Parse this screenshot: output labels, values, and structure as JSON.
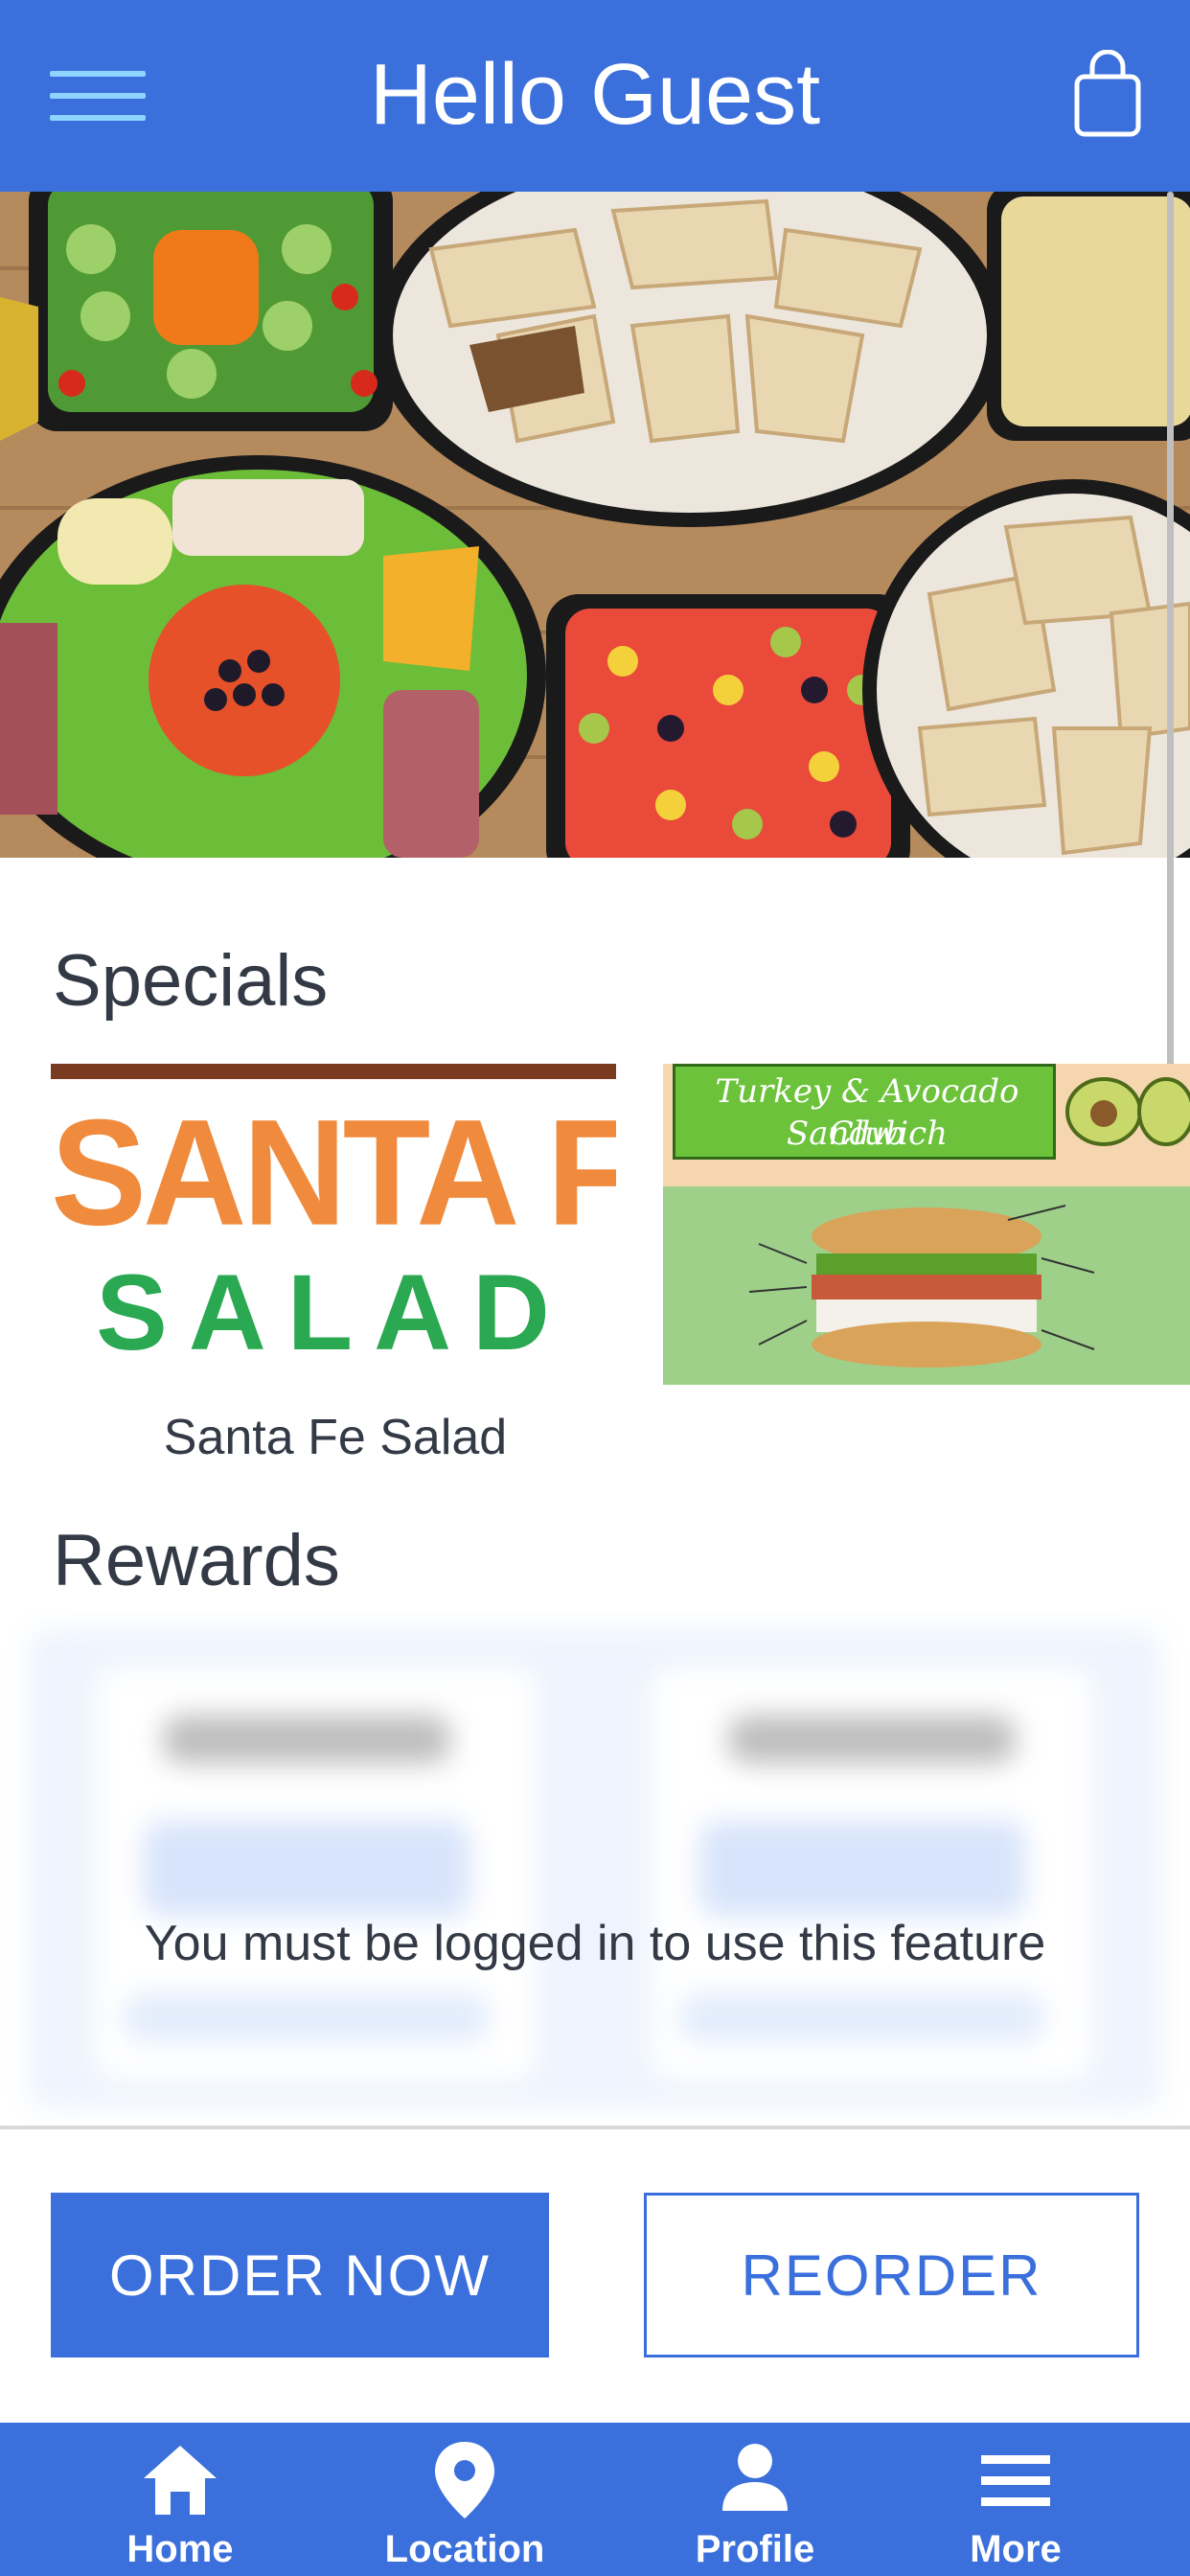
{
  "header": {
    "title": "Hello Guest",
    "menu_icon": "hamburger-menu-icon",
    "cart_icon": "shopping-bag-icon"
  },
  "hero": {
    "description_icon": "catering-platters-photo"
  },
  "specials": {
    "title": "Specials",
    "items": [
      {
        "label": "Santa Fe Salad",
        "art_line1": "SANTA FE",
        "art_line2": "SALAD"
      },
      {
        "label": "",
        "art_line1": "Turkey & Avocado Club",
        "art_line2": "Sandwich"
      }
    ]
  },
  "rewards": {
    "title": "Rewards",
    "locked_message": "You must be logged in to use this feature"
  },
  "actions": {
    "order_now": "ORDER NOW",
    "reorder": "REORDER"
  },
  "bottom_nav": [
    {
      "label": "Home",
      "icon": "home-icon"
    },
    {
      "label": "Location",
      "icon": "location-pin-icon"
    },
    {
      "label": "Profile",
      "icon": "profile-icon"
    },
    {
      "label": "More",
      "icon": "more-menu-icon"
    }
  ],
  "colors": {
    "brand_blue": "#3a6fdc",
    "menu_accent": "#8fd3ff",
    "text_dark": "#333a45",
    "salad_orange": "#f08a3c",
    "salad_green": "#2aa852"
  }
}
